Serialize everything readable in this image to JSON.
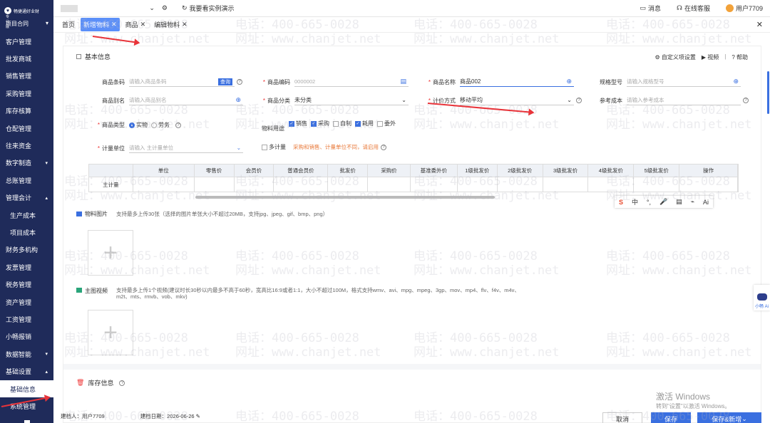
{
  "sidebar": {
    "brand": "畅捷通好业财",
    "edition": "专业版",
    "project": "项目合同",
    "items": [
      {
        "label": "客户管理",
        "caret": ""
      },
      {
        "label": "批发商城",
        "caret": ""
      },
      {
        "label": "销售管理",
        "caret": ""
      },
      {
        "label": "采购管理",
        "caret": ""
      },
      {
        "label": "库存核算",
        "caret": ""
      },
      {
        "label": "仓配管理",
        "caret": ""
      },
      {
        "label": "往来资金",
        "caret": ""
      },
      {
        "label": "数字制造",
        "caret": "▾"
      },
      {
        "label": "总账管理",
        "caret": ""
      },
      {
        "label": "管理会计",
        "caret": "▴"
      },
      {
        "label": "生产成本",
        "caret": "",
        "sub": true
      },
      {
        "label": "项目成本",
        "caret": "",
        "sub": true
      },
      {
        "label": "财务多机构",
        "caret": ""
      },
      {
        "label": "发票管理",
        "caret": ""
      },
      {
        "label": "税务管理",
        "caret": ""
      },
      {
        "label": "资产管理",
        "caret": ""
      },
      {
        "label": "工资管理",
        "caret": ""
      },
      {
        "label": "小畅报销",
        "caret": ""
      },
      {
        "label": "数据智能",
        "caret": "▾"
      },
      {
        "label": "基础设置",
        "caret": "▴"
      },
      {
        "label": "基础信息",
        "caret": "",
        "sub": true,
        "active": true
      },
      {
        "label": "系统管理",
        "caret": "",
        "sub": true
      }
    ]
  },
  "topbar": {
    "demo_link": "我要看实例演示",
    "messages": "消息",
    "support": "在线客服",
    "user": "用户7709"
  },
  "tabs": [
    {
      "label": "首页",
      "closable": false,
      "active": false
    },
    {
      "label": "新增物料",
      "closable": true,
      "active": true
    },
    {
      "label": "商品",
      "closable": true,
      "active": false
    },
    {
      "label": "编辑物料",
      "closable": true,
      "active": false
    }
  ],
  "basic": {
    "title": "基本信息",
    "custom_settings": "自定义项设置",
    "video": "视频",
    "help": "帮助",
    "barcode_label": "商品条码",
    "barcode_ph": "请输入商品条码",
    "query": "查询",
    "code_label": "商品编码",
    "code_ph": "0000002",
    "name_label": "商品名称",
    "name_value": "商品002",
    "spec_label": "规格型号",
    "spec_ph": "请输入规格型号",
    "alias_label": "商品别名",
    "alias_ph": "请输入商品别名",
    "category_label": "商品分类",
    "category_value": "未分类",
    "pricing_label": "计价方式",
    "pricing_value": "移动平均",
    "refcost_label": "参考成本",
    "refcost_ph": "请输入参考成本",
    "type_label": "商品类型",
    "type_opt1": "实物",
    "type_opt2": "劳务",
    "usage_label": "物料用途",
    "usage": [
      {
        "label": "销售",
        "checked": true
      },
      {
        "label": "采购",
        "checked": true
      },
      {
        "label": "自制",
        "checked": false
      },
      {
        "label": "耗用",
        "checked": true
      },
      {
        "label": "委外",
        "checked": false
      }
    ],
    "unit_label": "计量单位",
    "unit_ph": "请输入 主计量单位",
    "multi_unit": "多计量",
    "multi_warn": "采购和销售、计量单位不同，请启用"
  },
  "grid": {
    "headers": [
      "",
      "单位",
      "零售价",
      "会员价",
      "普通会员价",
      "批发价",
      "采购价",
      "基准委外价",
      "1级批发价",
      "2级批发价",
      "3级批发价",
      "4级批发价",
      "5级批发价",
      "操作"
    ],
    "row_label": "主计量"
  },
  "images": {
    "label": "物料图片",
    "desc": "支持最多上传30张（选择的图片单张大小不超过20MB，支持jpg、jpeg、gif、bmp、png）"
  },
  "video": {
    "label": "主图视频",
    "desc": "支持最多上传1个视频(建议时长30秒以内最多不高于60秒，宽高比16:9或者1:1，大小不超过100M，格式支持wmv、avi、mpg、mpeg、3gp、mov、mp4、flv、f4v、m4v、m2t、mts、rmvb、vob、mkv)"
  },
  "stock": {
    "title": "库存信息"
  },
  "ime": [
    "中",
    "°,",
    "🎤",
    "▤",
    "⌁",
    "Ai"
  ],
  "footer": {
    "creator": "建档人：用户7709",
    "created": "建档日期：2026-06-26",
    "cancel": "取消",
    "save": "保存",
    "save_new": "保存&新增"
  },
  "watermark": {
    "phone": "电话：400-665-0028",
    "site": "网址：www.chanjet.net"
  },
  "windows": {
    "title": "激活 Windows",
    "sub": "转到\"设置\"以激活 Windows。"
  },
  "assistant": "小畅 Ai",
  "colors": {
    "sidebar": "#1f2b5a",
    "accent": "#3a6fe0",
    "required": "#e33333",
    "warning": "#e8793a",
    "annotation_arrow": "#e8343a"
  }
}
